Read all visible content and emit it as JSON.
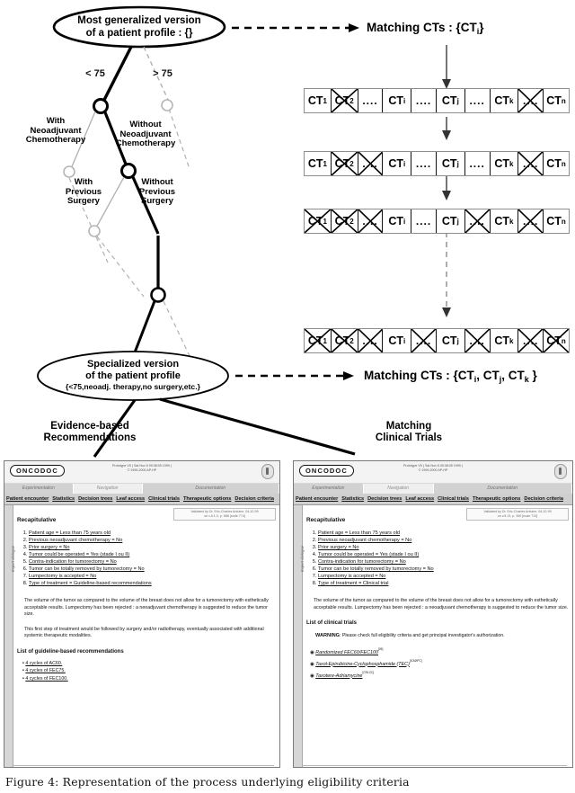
{
  "figure": {
    "caption": "Figure 4: Representation of the process underlying eligibility criteria"
  },
  "tree": {
    "root_ellipse": {
      "line1": "Most generalized version",
      "line2": "of a patient profile : {}"
    },
    "leaf_ellipse": {
      "line1": "Specialized version",
      "line2": "of the patient profile",
      "line3": "{<75,neoadj. therapy,no surgery,etc.}"
    },
    "branch_labels": {
      "age_lt": "< 75",
      "age_gt": "> 75",
      "with_neo": "With\nNeoadjuvant\nChemotherapy",
      "without_neo": "Without\nNeoadjuvant\nChemotherapy",
      "with_surgery": "With\nPrevious\nSurgery",
      "without_surgery": "Without\nPrevious\nSurgery"
    },
    "with_neo_l1": "With",
    "with_neo_l2": "Neoadjuvant",
    "with_neo_l3": "Chemotherapy",
    "without_neo_l1": "Without",
    "without_neo_l2": "Neoadjuvant",
    "without_neo_l3": "Chemotherapy",
    "with_surg_l1": "With",
    "with_surg_l2": "Previous",
    "with_surg_l3": "Surgery",
    "without_surg_l1": "Without",
    "without_surg_l2": "Previous",
    "without_surg_l3": "Surgery"
  },
  "matching": {
    "top_label": "Matching CTs : {CT",
    "top_sub": "i",
    "top_close": "}",
    "bottom_label": "Matching CTs : {CT",
    "bottom_subs": [
      "i",
      "j",
      "k"
    ],
    "bottom_text_full": "Matching CTs : {CT i , CT j , CT k }"
  },
  "ct_rows": [
    {
      "cells": [
        {
          "label": "CT",
          "sub": "1",
          "crossed": false,
          "dots": false
        },
        {
          "label": "CT",
          "sub": "2",
          "crossed": true,
          "dots": false
        },
        {
          "label": "....",
          "sub": "",
          "crossed": false,
          "dots": true
        },
        {
          "label": "CT",
          "sub": "i",
          "crossed": false,
          "dots": false
        },
        {
          "label": "....",
          "sub": "",
          "crossed": false,
          "dots": true
        },
        {
          "label": "CT",
          "sub": "j",
          "crossed": false,
          "dots": false
        },
        {
          "label": "....",
          "sub": "",
          "crossed": false,
          "dots": true
        },
        {
          "label": "CT",
          "sub": "k",
          "crossed": false,
          "dots": false
        },
        {
          "label": "....",
          "sub": "",
          "crossed": true,
          "dots": true
        },
        {
          "label": "CT",
          "sub": "n",
          "crossed": false,
          "dots": false
        }
      ]
    },
    {
      "cells": [
        {
          "label": "CT",
          "sub": "1",
          "crossed": false,
          "dots": false
        },
        {
          "label": "CT",
          "sub": "2",
          "crossed": true,
          "dots": false
        },
        {
          "label": "....",
          "sub": "",
          "crossed": true,
          "dots": true
        },
        {
          "label": "CT",
          "sub": "i",
          "crossed": false,
          "dots": false
        },
        {
          "label": "....",
          "sub": "",
          "crossed": false,
          "dots": true
        },
        {
          "label": "CT",
          "sub": "j",
          "crossed": false,
          "dots": false
        },
        {
          "label": "....",
          "sub": "",
          "crossed": false,
          "dots": true
        },
        {
          "label": "CT",
          "sub": "k",
          "crossed": false,
          "dots": false
        },
        {
          "label": "....",
          "sub": "",
          "crossed": true,
          "dots": true
        },
        {
          "label": "CT",
          "sub": "n",
          "crossed": false,
          "dots": false
        }
      ]
    },
    {
      "cells": [
        {
          "label": "CT",
          "sub": "1",
          "crossed": true,
          "dots": false
        },
        {
          "label": "CT",
          "sub": "2",
          "crossed": true,
          "dots": false
        },
        {
          "label": "....",
          "sub": "",
          "crossed": true,
          "dots": true
        },
        {
          "label": "CT",
          "sub": "i",
          "crossed": false,
          "dots": false
        },
        {
          "label": "....",
          "sub": "",
          "crossed": false,
          "dots": true
        },
        {
          "label": "CT",
          "sub": "j",
          "crossed": false,
          "dots": false
        },
        {
          "label": "....",
          "sub": "",
          "crossed": true,
          "dots": true
        },
        {
          "label": "CT",
          "sub": "k",
          "crossed": false,
          "dots": false
        },
        {
          "label": "....",
          "sub": "",
          "crossed": true,
          "dots": true
        },
        {
          "label": "CT",
          "sub": "n",
          "crossed": false,
          "dots": false
        }
      ]
    },
    {
      "cells": [
        {
          "label": "CT",
          "sub": "1",
          "crossed": true,
          "dots": false
        },
        {
          "label": "CT",
          "sub": "2",
          "crossed": true,
          "dots": false
        },
        {
          "label": "....",
          "sub": "",
          "crossed": true,
          "dots": true
        },
        {
          "label": "CT",
          "sub": "i",
          "crossed": false,
          "dots": false
        },
        {
          "label": "....",
          "sub": "",
          "crossed": true,
          "dots": true
        },
        {
          "label": "CT",
          "sub": "j",
          "crossed": false,
          "dots": false
        },
        {
          "label": "....",
          "sub": "",
          "crossed": true,
          "dots": true
        },
        {
          "label": "CT",
          "sub": "k",
          "crossed": false,
          "dots": false
        },
        {
          "label": "....",
          "sub": "",
          "crossed": true,
          "dots": true
        },
        {
          "label": "CT",
          "sub": "n",
          "crossed": true,
          "dots": false
        }
      ]
    }
  ],
  "section_headers": {
    "left_l1": "Evidence-based",
    "left_l2": "Recommendations",
    "right_l1": "Matching",
    "right_l2": "Clinical Trials"
  },
  "app": {
    "logo": "ONCODOC",
    "proto_line1": "Prototype V5 ( Sat Nov 6 09:38:05 1999 )",
    "proto_line2": "© 1999-2000 AP-HP",
    "sections": [
      "Experimentation",
      "Navigation",
      "Documentation"
    ],
    "tabs": [
      "Patient encounter",
      "Statistics",
      "Decision trees",
      "Leaf access",
      "Clinical trials",
      "Therapeutic options",
      "Decision criteria"
    ],
    "side_tab": "Expert dialogue",
    "validated_left_l1": "Validated by Dr. Eric-Charles Antoine, 04-10-99",
    "validated_left_l2": "on v.5.1.3, p. 588 [node 774]",
    "validated_right_l1": "Validated by Dr. Eric-Charles Antoine, 04-10-99",
    "validated_right_l2": "on v.5.13, p. 390 [node 713]",
    "recap_title": "Recapitulative"
  },
  "left_panel": {
    "criteria": [
      "Patient age = Less than 75 years old",
      "Previous neoadjuvant chemotherapy = No",
      "Prior surgery = No",
      "Tumor could be operated = Yes (stade I ou II)",
      "Contra-indication for tumorectomy = No",
      "Tumor can be totally removed by tumorectomy = No",
      "Lumpectomy is accepted = No",
      "Type of treatment = Guideline-based recommendations"
    ],
    "para1": "The volume of the tumor as compared to the volume of the breast does not allow for a tumorectomy with esthetically acceptable results. Lumpectomy has been rejected : a neoadjuvant chemotherapy is suggested to reduce the tumor size.",
    "para2": "This first step of treatment would be followed by surgery and/or radiotherapy, eventually associated with additional systemic therapeutic modalities.",
    "list_title": "List of guideline-based recommendations",
    "recommendations": [
      "4 cycles of AC60.",
      "4 cycles of FEC75.",
      "4 cycles of FEC100."
    ]
  },
  "right_panel": {
    "criteria": [
      "Patient age = Less than 75 years old",
      "Previous neoadjuvant chemotherapy = No",
      "Prior surgery = No",
      "Tumor could be operated = Yes (stade I ou II)",
      "Contra-indication for tumorectomy = No",
      "Tumor can be totally removed by tumorectomy = No",
      "Lumpectomy is accepted = No",
      "Type of treatment = Clinical trial"
    ],
    "para1": "The volume of the tumor as compared to the volume of the breast does not allow for a tumorectomy with esthetically acceptable results. Lumpectomy has been rejected : a neoadjuvant chemotherapy is suggested to reduce the tumor size.",
    "list_title": "List of clinical trials",
    "warning_label": "WARNING",
    "warning_text": ": Please check full eligibility criteria and get principal investigator's authorization.",
    "trials": [
      {
        "name": "Randomized FEC60/FEC100",
        "sup": "[05]"
      },
      {
        "name": "Taxol-Epirubicine-Cyclophosphamide (TEC)",
        "sup": "[ICM/IPC]"
      },
      {
        "name": "Taxotere-Adriamycine",
        "sup": "[CRLCC]"
      }
    ]
  },
  "colors": {
    "ink": "#000000",
    "grey_line": "#9a9a9a",
    "panel_bg": "#ffffff",
    "tab_bg": "#cfcfcf"
  }
}
